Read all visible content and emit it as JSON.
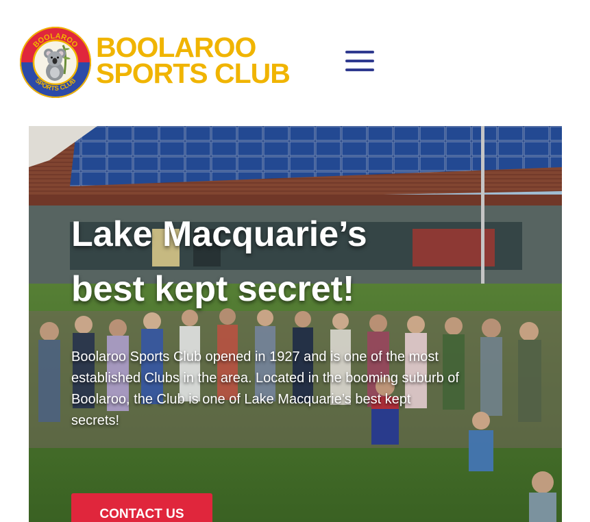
{
  "header": {
    "brand_line1": "BOOLAROO",
    "brand_line2": "SPORTS CLUB",
    "logo_ring_top": "BOOLAROO",
    "logo_ring_bottom": "SPORTS CLUB",
    "menu_icon": "hamburger-menu-icon"
  },
  "hero": {
    "heading_line1": "Lake Macquarie’s",
    "heading_line2": "best kept secret!",
    "body": "Boolaroo Sports Club opened in 1927 and is one of the most established Clubs in the area. Located in the booming suburb of Boolaroo, the Club is one of Lake Macquarie’s best kept secrets!",
    "cta_label": "CONTACT US"
  },
  "colors": {
    "brand_gold": "#f0b400",
    "menu_navy": "#2f3a8f",
    "cta_red": "#e0263c",
    "logo_ring_red": "#e0263c",
    "logo_ring_blue": "#2c4aa8"
  }
}
